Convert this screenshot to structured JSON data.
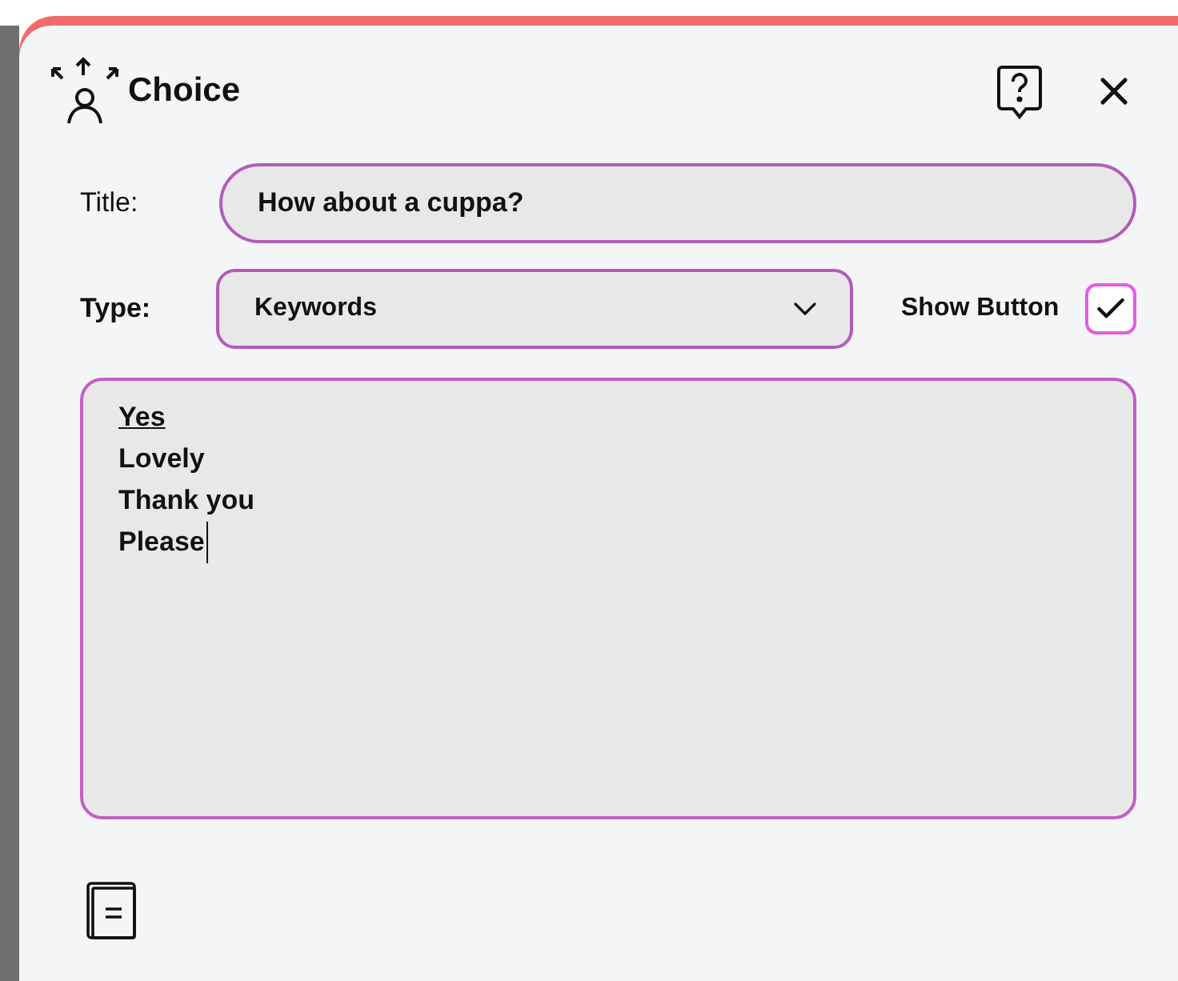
{
  "dialog": {
    "title": "Choice"
  },
  "title_field": {
    "label": "Title:",
    "value": "How about a cuppa?"
  },
  "type_field": {
    "label": "Type:",
    "value": "Keywords"
  },
  "show_button": {
    "label": "Show Button",
    "checked": true
  },
  "keywords": [
    {
      "text": "Yes",
      "underlined": true
    },
    {
      "text": "Lovely",
      "underlined": false
    },
    {
      "text": "Thank you",
      "underlined": false
    },
    {
      "text": "Please",
      "underlined": false
    }
  ]
}
